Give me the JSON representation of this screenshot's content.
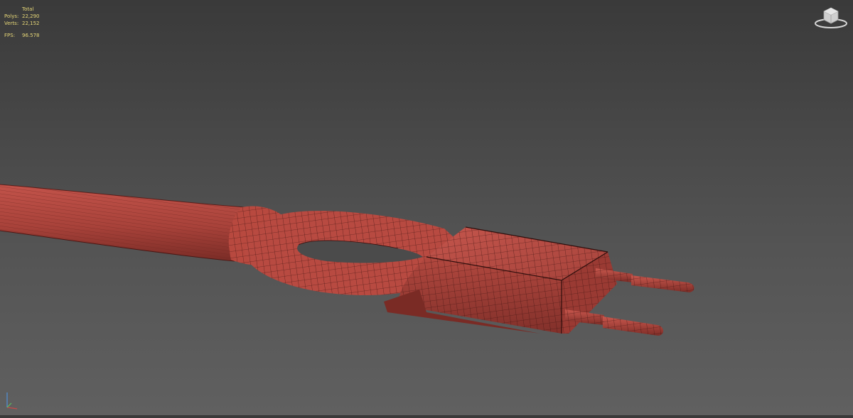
{
  "stats": {
    "column_header": "Total",
    "polys_label": "Polys:",
    "polys_value": "22,290",
    "verts_label": "Verts:",
    "verts_value": "22,152",
    "fps_label": "FPS:",
    "fps_value": "96.578"
  },
  "colors": {
    "stats_text": "#e8d878",
    "mesh_fill": "#b5473f",
    "wire": "#3a1210",
    "background_top": "#3a3a3a",
    "background_bottom": "#606060"
  },
  "icons": [
    "viewcube-icon",
    "axis-tripod-icon"
  ]
}
